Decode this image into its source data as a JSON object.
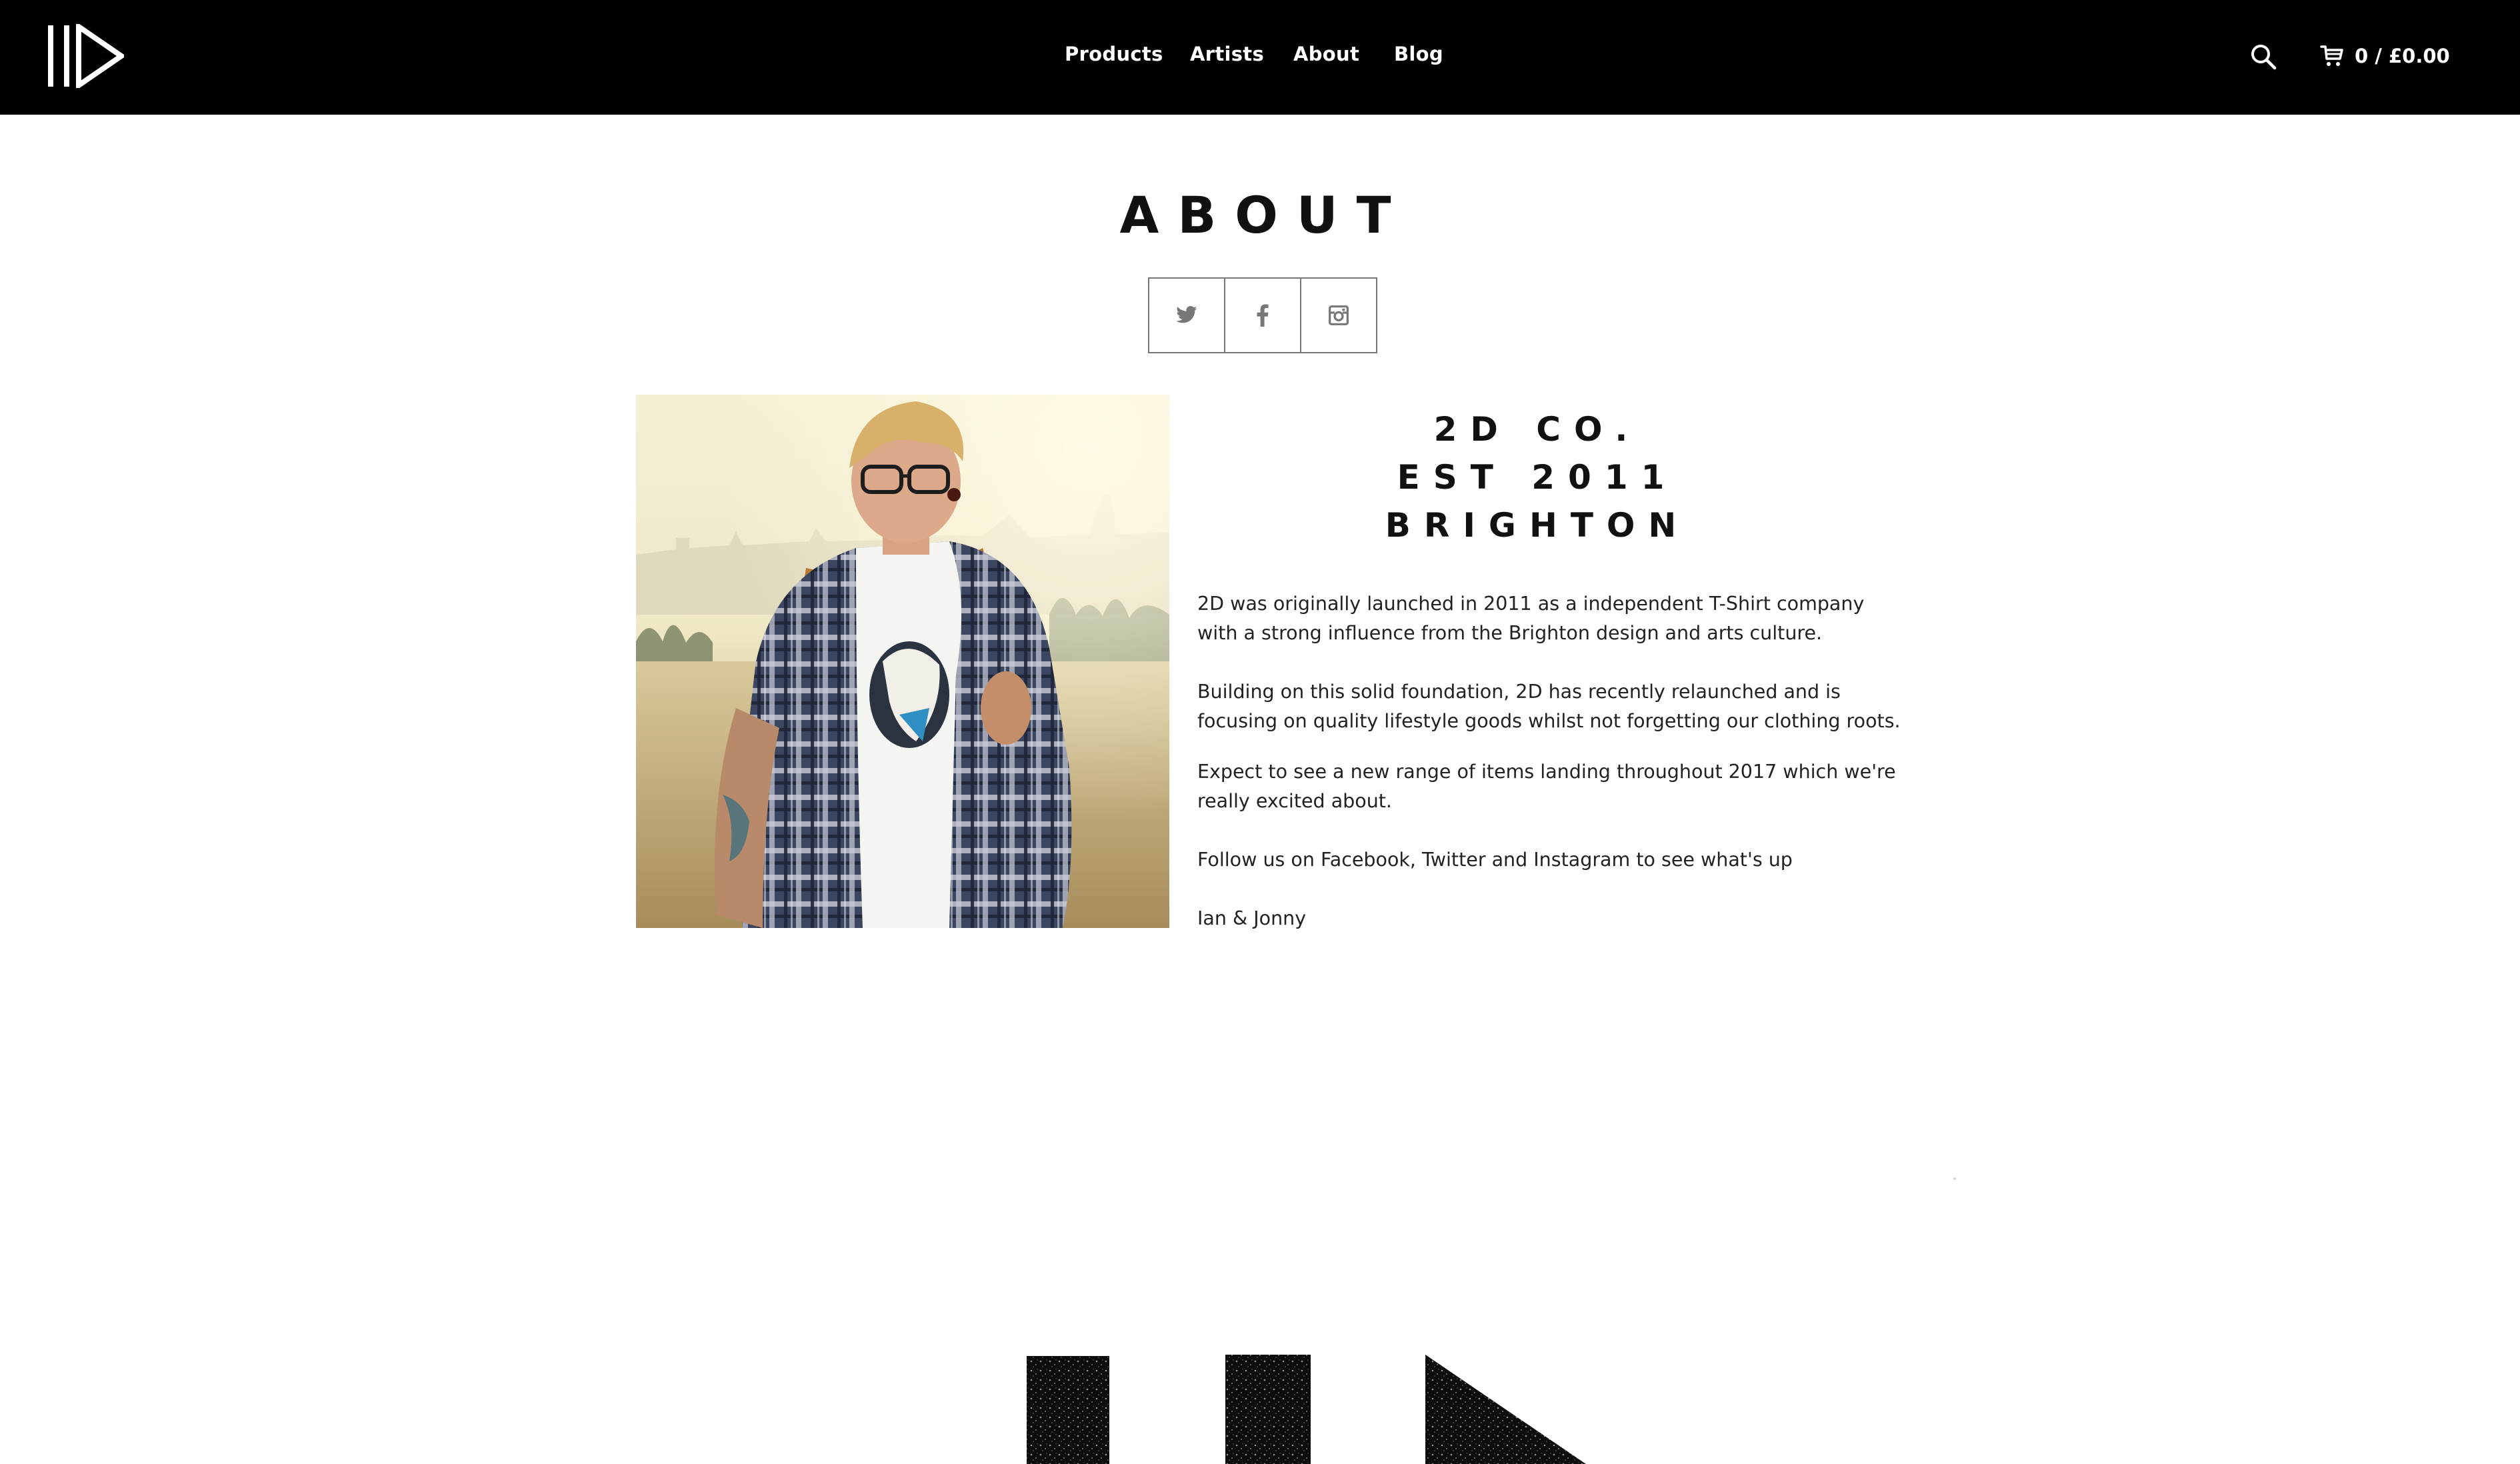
{
  "header": {
    "logo_alt": "2D",
    "nav": [
      {
        "label": "Products"
      },
      {
        "label": "Artists"
      },
      {
        "label": "About"
      },
      {
        "label": "Blog"
      }
    ],
    "search_icon": "search-icon",
    "cart_icon": "cart-icon",
    "cart_label": "0 / £0.00"
  },
  "main": {
    "title": "ABOUT",
    "social": [
      {
        "name": "twitter",
        "icon": "twitter-icon"
      },
      {
        "name": "facebook",
        "icon": "facebook-icon"
      },
      {
        "name": "instagram",
        "icon": "instagram-icon"
      }
    ],
    "heading_lines": [
      "2D CO.",
      "EST 2011",
      "BRIGHTON"
    ],
    "paragraphs": [
      "2D was originally launched in 2011 as a independent T-Shirt company with a strong influence from the Brighton design and arts culture.",
      "Building on this solid foundation, 2D has recently relaunched and is focusing on quality lifestyle goods whilst not forgetting our clothing roots.",
      "Expect to see a new range of items landing throughout 2017 which we're really excited about.",
      "Follow us on Facebook, Twitter and Instagram to see what's up",
      "Ian & Jonny"
    ]
  },
  "colors": {
    "header_bg": "#000000",
    "header_text": "#ffffff",
    "page_bg": "#ffffff",
    "text": "#1a1a1a",
    "social_border": "#777777"
  }
}
